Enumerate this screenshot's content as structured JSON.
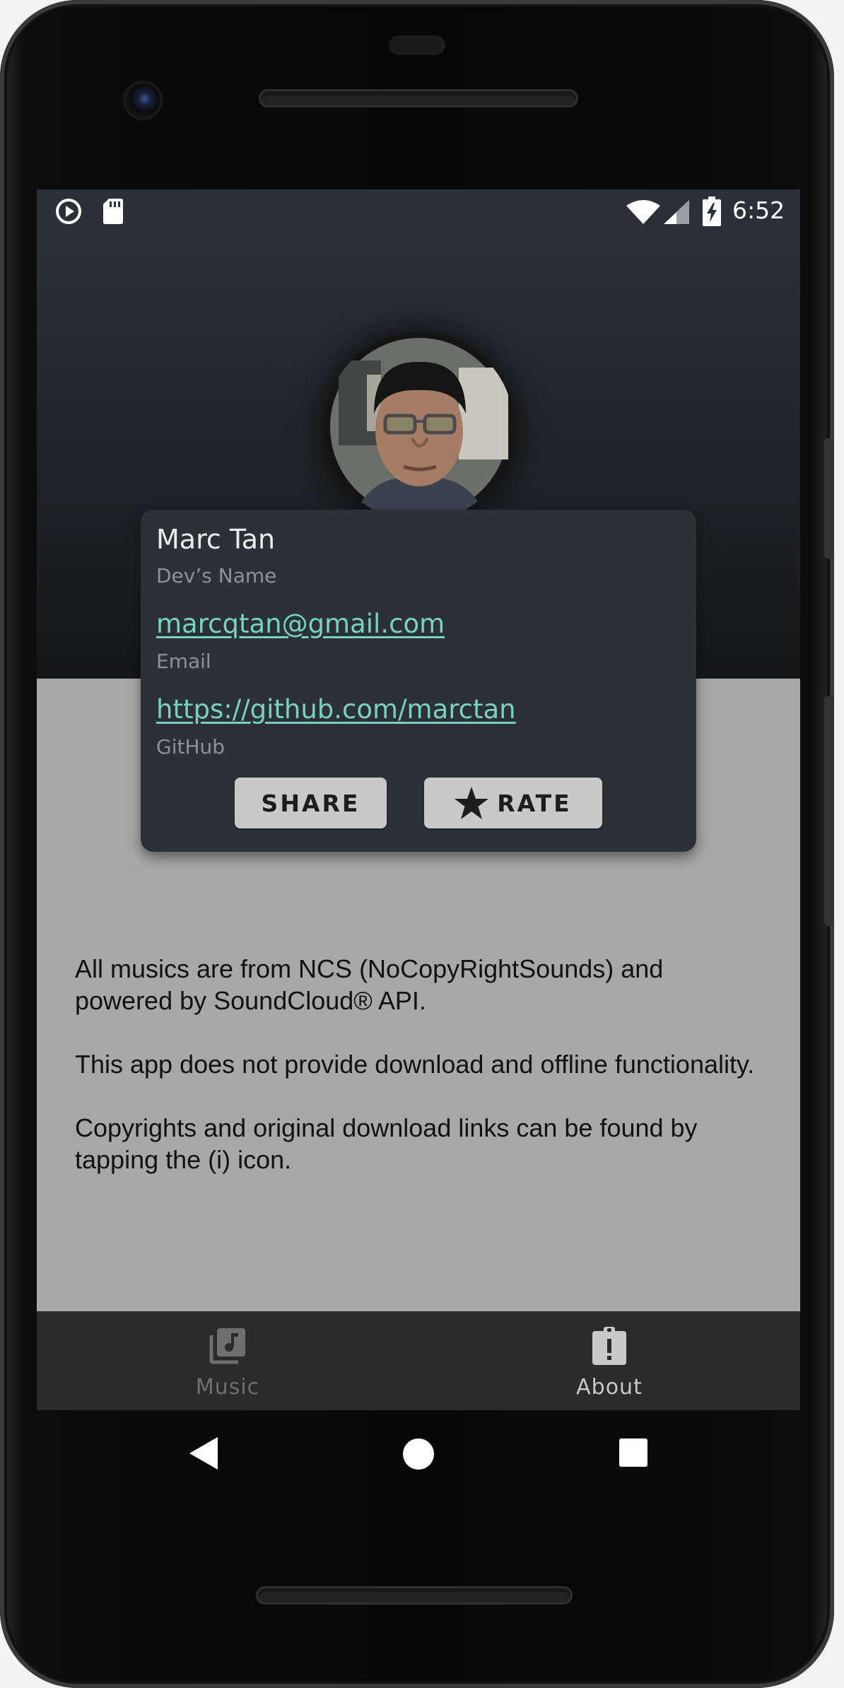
{
  "status_bar": {
    "time": "6:52",
    "icons": [
      "play-circle-icon",
      "sd-card-icon",
      "wifi-icon",
      "cell-signal-icon",
      "battery-charging-icon"
    ]
  },
  "profile": {
    "name": "Marc Tan",
    "name_caption": "Dev’s Name",
    "email": "marcqtan@gmail.com",
    "email_caption": "Email",
    "github": "https://github.com/marctan",
    "github_caption": "GitHub"
  },
  "actions": {
    "share_label": "SHARE",
    "rate_label": "RATE"
  },
  "about": {
    "paragraphs": [
      "All musics are from NCS (NoCopyRightSounds) and powered by SoundCloud® API.",
      "This app does not provide download and offline functionality.",
      "Copyrights and original download links can be found by tapping the (i) icon."
    ]
  },
  "bottom_nav": {
    "items": [
      {
        "label": "Music",
        "icon": "music-library-icon",
        "selected": false
      },
      {
        "label": "About",
        "icon": "about-info-icon",
        "selected": true
      }
    ]
  },
  "colors": {
    "card_bg": "#2c3138",
    "link": "#79d1c1",
    "content_bg": "#a8a8a8",
    "status_bar": "#2b3038"
  }
}
